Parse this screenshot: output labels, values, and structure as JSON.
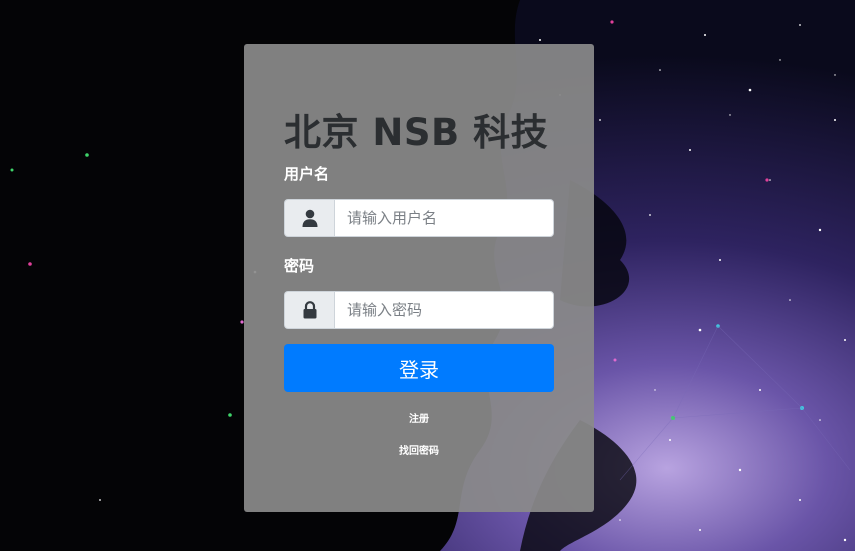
{
  "colors": {
    "accent": "#007bff",
    "card": "#8a8a8a",
    "title": "#2b2e31"
  },
  "login": {
    "title": "北京 NSB 科技",
    "username": {
      "label": "用户名",
      "icon": "user-icon",
      "placeholder": "请输入用户名",
      "value": ""
    },
    "password": {
      "label": "密码",
      "icon": "lock-icon",
      "placeholder": "请输入密码",
      "value": ""
    },
    "submit_label": "登录",
    "register_link": "注册",
    "forgot_link": "找回密码"
  }
}
